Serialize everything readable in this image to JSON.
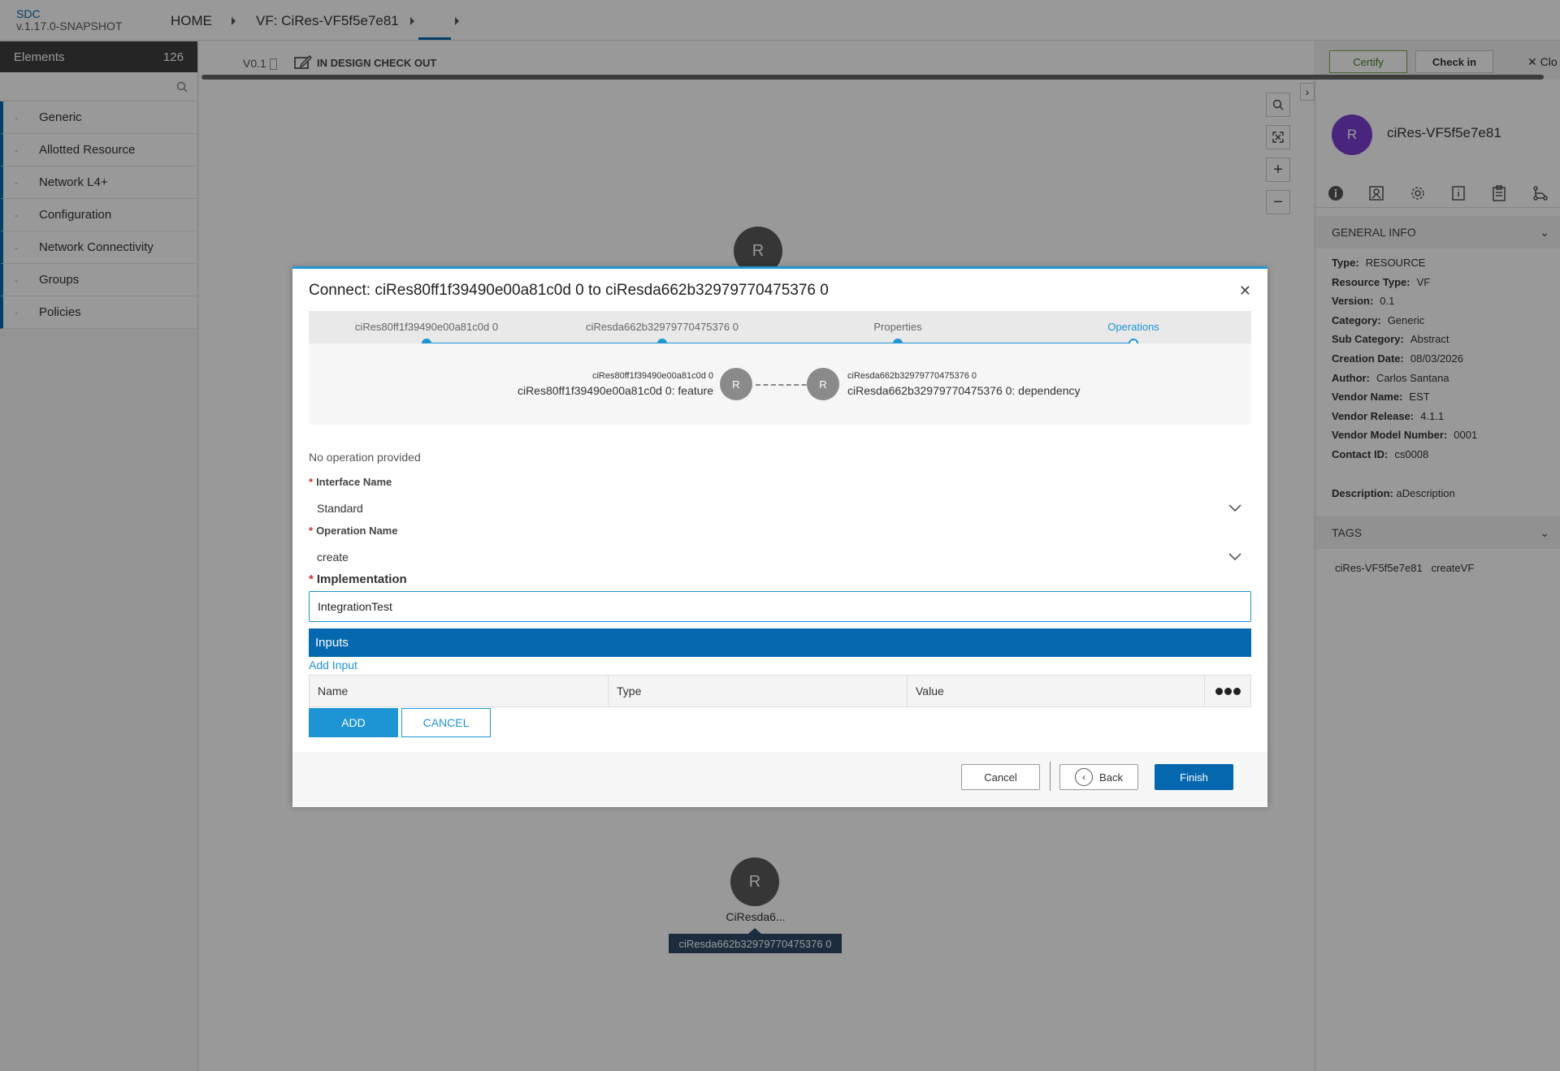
{
  "app": {
    "name": "SDC",
    "version": "v.1.17.0-SNAPSHOT"
  },
  "nav": {
    "home": "HOME",
    "breadcrumb_vf": "VF: CiRes-VF5f5e7e81"
  },
  "elements_panel": {
    "title": "Elements",
    "count": "126",
    "search_placeholder": "",
    "categories": [
      "Generic",
      "Allotted Resource",
      "Network L4+",
      "Configuration",
      "Network Connectivity",
      "Groups",
      "Policies"
    ]
  },
  "toolbar": {
    "version": "V0.1",
    "status": "IN DESIGN CHECK OUT",
    "certify": "Certify",
    "check_in": "Check in",
    "close": "Clo"
  },
  "canvas": {
    "node_letter": "R",
    "bottom_node_label": "CiResda6...",
    "bottom_node_tooltip": "ciResda662b32979770475376 0"
  },
  "right_panel": {
    "avatar": "R",
    "name": "ciRes-VF5f5e7e81",
    "general_info_title": "GENERAL INFO",
    "info": [
      {
        "k": "Type:",
        "v": "RESOURCE"
      },
      {
        "k": "Resource Type:",
        "v": "VF"
      },
      {
        "k": "Version:",
        "v": "0.1"
      },
      {
        "k": "Category:",
        "v": "Generic"
      },
      {
        "k": "Sub Category:",
        "v": "Abstract"
      },
      {
        "k": "Creation Date:",
        "v": "08/03/2026"
      },
      {
        "k": "Author:",
        "v": "Carlos Santana"
      },
      {
        "k": "Vendor Name:",
        "v": "EST"
      },
      {
        "k": "Vendor Release:",
        "v": "4.1.1"
      },
      {
        "k": "Vendor Model Number:",
        "v": "0001"
      },
      {
        "k": "Contact ID:",
        "v": "cs0008"
      }
    ],
    "description_label": "Description:",
    "description": "aDescription",
    "tags_title": "TAGS",
    "tags": [
      "ciRes-VF5f5e7e81",
      "createVF"
    ]
  },
  "modal": {
    "title": "Connect: ciRes80ff1f39490e00a81c0d 0 to ciResda662b32979770475376 0",
    "steps": [
      "ciRes80ff1f39490e00a81c0d 0",
      "ciResda662b32979770475376 0",
      "Properties",
      "Operations"
    ],
    "relation": {
      "from_small": "ciRes80ff1f39490e00a81c0d 0",
      "from_big": "ciRes80ff1f39490e00a81c0d 0: feature",
      "to_small": "ciResda662b32979770475376 0",
      "to_big": "ciResda662b32979770475376 0: dependency",
      "node_letter": "R"
    },
    "no_operation": "No operation provided",
    "interface_label": "Interface Name",
    "interface_value": "Standard",
    "operation_label": "Operation Name",
    "operation_value": "create",
    "implementation_label": "Implementation",
    "implementation_value": "IntegrationTest",
    "inputs_title": "Inputs",
    "add_input": "Add Input",
    "columns": [
      "Name",
      "Type",
      "Value"
    ],
    "add_button": "ADD",
    "cancel_input_button": "CANCEL",
    "footer": {
      "cancel": "Cancel",
      "back": "Back",
      "finish": "Finish"
    }
  },
  "colors": {
    "accent": "#1d95d4",
    "primary": "#0568ae",
    "certify": "#76a94f",
    "avatar": "#7a3fd0"
  }
}
